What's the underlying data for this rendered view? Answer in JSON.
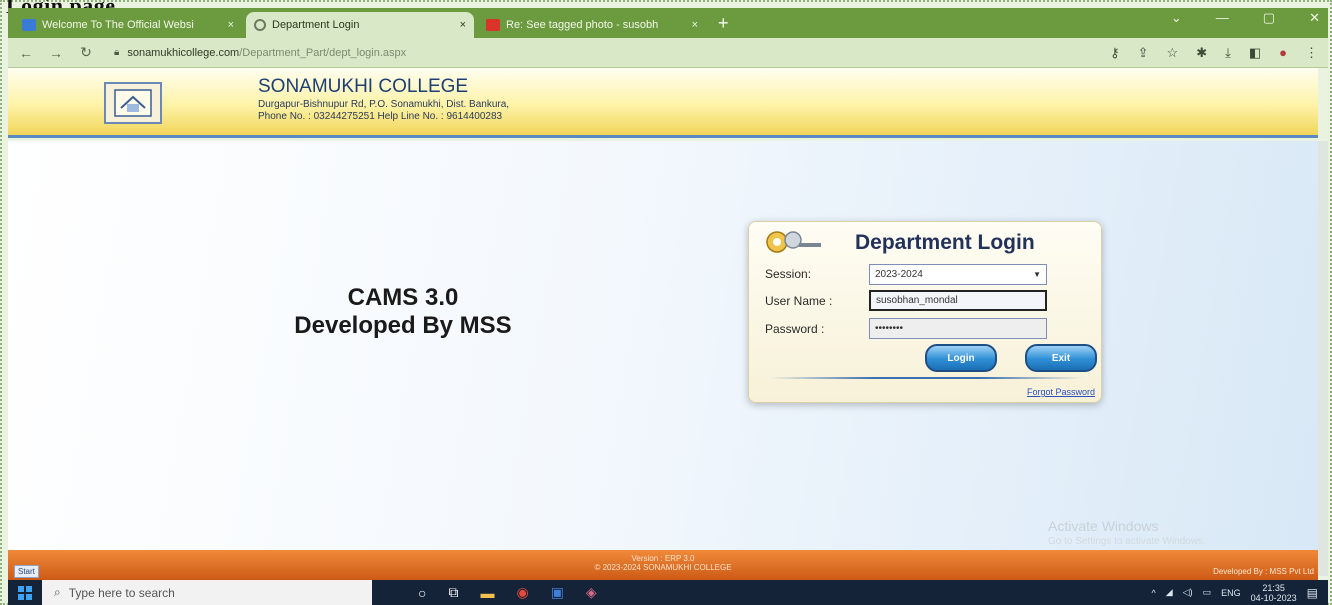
{
  "outer_title": "Login page",
  "browser": {
    "tabs": [
      {
        "title": "Welcome To The Official Websi",
        "close": "×",
        "active": false,
        "fav_color": "#3a7bd5"
      },
      {
        "title": "Department Login",
        "close": "×",
        "active": true,
        "fav_color": "#8a8a8a"
      },
      {
        "title": "Re: See tagged photo - susobh",
        "close": "×",
        "active": false,
        "fav_color": "#d9332a"
      }
    ],
    "new_tab": "+",
    "window_controls": [
      "⌄",
      "—",
      "▢",
      "✕"
    ],
    "url": {
      "domain": "sonamukhicollege.com",
      "path": "/Department_Part/dept_login.aspx"
    }
  },
  "site": {
    "college_name": "SONAMUKHI COLLEGE",
    "address_line1": "Durgapur-Bishnupur Rd, P.O. Sonamukhi, Dist. Bankura,",
    "address_line2": "Phone No. : 03244275251  Help Line No. : 9614400283"
  },
  "main": {
    "cams_line1": "CAMS 3.0",
    "cams_line2": "Developed By MSS",
    "activate_line1": "Activate Windows",
    "activate_line2": "Go to Settings to activate Windows."
  },
  "login": {
    "title": "Department Login",
    "session_label": "Session:",
    "session_value": "2023-2024",
    "username_label": "User Name :",
    "username_value": "susobhan_mondal",
    "password_label": "Password :",
    "password_value": "••••••••",
    "login_button": "Login",
    "exit_button": "Exit",
    "forgot_link": "Forgot Password"
  },
  "footer": {
    "version": "Version : ERP 3.0",
    "copyright": "© 2023-2024  SONAMUKHI COLLEGE",
    "developed_by": "Developed By : MSS Pvt Ltd",
    "start_label": "Start"
  },
  "taskbar": {
    "search_placeholder": "Type here to search",
    "lang": "ENG",
    "time": "21:35",
    "date": "04-10-2023"
  },
  "colors": {
    "header_border": "#5a8ac0",
    "footer_bg": "#cc5a16",
    "taskbar_bg": "#142338",
    "tab_strip": "#6b9a3f"
  }
}
